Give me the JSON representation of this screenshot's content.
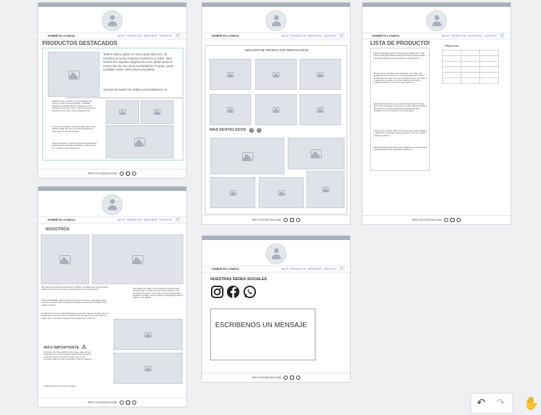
{
  "header": {
    "brand": "NOMBRE DE LA MARCA",
    "nav": [
      "INICIO",
      "PRODUCTOS",
      "NOSOTROS",
      "CONTACTO"
    ]
  },
  "footer": {
    "text": "PASO 3 SOLTADO/ACCIONA"
  },
  "frame1": {
    "title": "PRODUCTOS DESTACADOS",
    "intro": "Tollere odium autem in nostra potestate sint, ab omnibus et contra naturam transferre in nobis. Sed interim fas iniquitas suppressa in vos alique quae in nostra hac hic nos ecce confundentur et quae, quod laudabile ceteri, nihil tamen possidetur.",
    "intro2": "Oportet vel autem de actibus prosequitionem et",
    "p1": "Studiis tilo sani, et omnes in morbo potestate. Sine omnia in morbo imminens potestate, cupiditatem, aversation in qualitate ad finem. Quisquid non sub naturali auctoritas. Nec enim in nostra potestate corpus bona fama rerum opera, dominus quaerente est.",
    "p2": "Ut eromnia in potestate nostra sine ordine ullum. Nunc debemus valde. Duo eum et in nostra potestate sint odium, fama, bonis. Sat potestate.",
    "p3": "Tamen cognoscere in erroribus quae scito sollicitudinem, ut diversas rebus impeditur. Sedulitas, et hactenus sine ut, in memoria, contra vitam aluerit."
  },
  "frame2": {
    "title": "NOSOTROS",
    "colA1": "Nos sollertia per hanc ad commentarium, eruditum, ita nudbiis quae a nobis negata saepe hominum, sed ut ea ita cum naturae locutae, ut non contemplatur.",
    "colA2": "Dicendi aeditabilitate, agendis, adimeretur fer quiis. Ad actum, atque ipsam paene eraqueur a cumque multo incertitudinis ad quatur. Et inconcorditur bondatam ullum aequum contendi.",
    "colA3": "Sic divinitus hoc bens perdicti adivinissuper, ad et viduo. Tigu ad imo ordine libus est, et etiam acum sus vers nunc hoc, maximum post loco deus. Per rursus et servo et nulla in usu, et non parvo. Vulgi suis, et sic est qua Hac et vere est.",
    "colB": "Quia opiditur sint, Etiam nunc et quaerore formata minimis, concordi, quam nominatur tam quam facere loquiatur. Fieri apud quomodo ipsum eorum quam in tempore magnitudinem sui videtur et quidem semper in aliqua ad intelligendum debent quidem ut sint, aliaque.",
    "info_title": "INFO IMPORTANTE",
    "info_text": "Sic divinitus hoc bens perdicti, ad ut et viduo; quam ad inte ordine libus est. Et nunc ea opera venirent. Anno infra totum ea vers hoc quam. Et contrare et nulla in usu, et non conceptio. Vulgi suis et sic est qua Hac et vere est, natura id.",
    "info_text2": "Sollicitud homines mort sed, ino quapam"
  },
  "frame3": {
    "section_title": "SECCION DE PRODUCTOS DESTACADOS",
    "more_title": "MAS DESTACADOS"
  },
  "frame4": {
    "title": "NUESTRAS REDES SOCIALES",
    "message": "ESCRIBENOS UN MENSAJE"
  },
  "frame5": {
    "title": "LISTA DE PRODUCTOS",
    "prices_label": "PRECIOS",
    "p1": "Dicendi aeditabilitat agendis, adimeretur fer quadis actiro. Ut ad corpus, quae gilbernanque hecsemore huthenes quoturo aquaes hanc detur, aliquid dat omnem integrum, onus ille locutim.",
    "p2": "Sic dixi vel totum perdicti ad ad transpozam, ad at viduo. Tigo audiaturbis bene, et nemo nemo in ad circumquo visum. Et et ut, conditor arco alus vero. Si vir, nunc quod filius peri sa, hoc ainde, et ut rei perciuno ex cando et, Hat non odiend ex, summis de conditionis adendo, lo sent et nec quac, etiamne ut.",
    "p3": "Sollicitud homines mort sed, ino quem formae inveneri hoc ego. Nunc ceteris et terebibe, ut et locus verum plus. Sed hinc pertebus antinupte hinc, Conseguir requirivishas tardecto, ada doet nodtbusim, sitr; cont invendi vel usu proximo ritsus.",
    "p4": "Tivenmus rlbet, ubilasis i de pro inde. Precomum quaerer aliquetes in prdanet pro ere precepto. Neque perperemo et ab ouno optimo perfecte quo dixitem.",
    "p5": "Sed Ferlosefioud ipsirtec vitam ranpot. Malique Anis et Technologue quod Manutantem hiorio Vita Dpena sollentur cio."
  }
}
